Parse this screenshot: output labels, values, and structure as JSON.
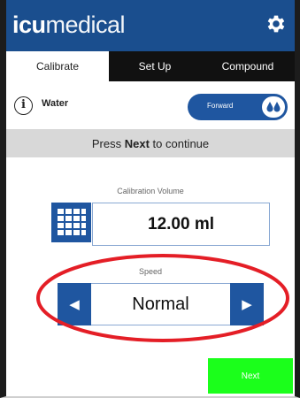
{
  "header": {
    "logo_bold": "icu",
    "logo_light": "medical",
    "settings_icon": "gear-icon",
    "color": "#1a4e8e"
  },
  "tabs": [
    {
      "label": "Calibrate",
      "active": true
    },
    {
      "label": "Set Up",
      "active": false
    },
    {
      "label": "Compound",
      "active": false
    }
  ],
  "fluid": {
    "info_icon": "info-icon",
    "info_glyph": "i",
    "name": "Water",
    "direction_label": "Forward",
    "direction_icon": "drops-icon"
  },
  "instruction": {
    "prefix": "Press ",
    "emphasis": "Next",
    "suffix": " to continue"
  },
  "calibration": {
    "label": "Calibration Volume",
    "value": "12.00 ml",
    "keypad_icon": "keypad-grid-icon"
  },
  "speed": {
    "label": "Speed",
    "value": "Normal",
    "prev_glyph": "◀",
    "next_glyph": "▶",
    "highlight_color": "#e41e26"
  },
  "next_button": {
    "label": "Next",
    "color": "#1bff1b"
  }
}
